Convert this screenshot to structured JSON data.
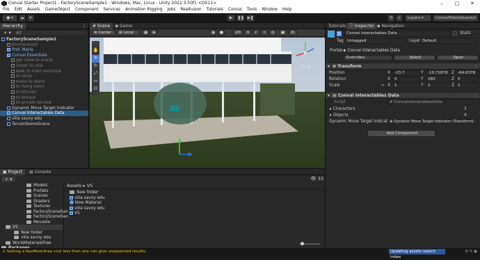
{
  "window": {
    "title": "Convai Starter Project1 - FactorySceneSample1 - Windows, Mac, Linux - Unity 2022.3.50f1 <DX11>"
  },
  "menu": [
    "File",
    "Edit",
    "Assets",
    "GameObject",
    "Component",
    "Services",
    "Animation Rigging",
    "Jobs",
    "Realtusion",
    "Tutorials",
    "Convai",
    "Tools",
    "Window",
    "Help"
  ],
  "toolbar": {
    "layers": "Layers",
    "layout": "ConvaiTutorialLayout"
  },
  "hierarchy": {
    "tab": "Hierarchy",
    "search_placeholder": "All",
    "rows": [
      {
        "label": "FactorySceneSample1",
        "style": "scene"
      },
      {
        "label": "Environment",
        "style": "dim"
      },
      {
        "label": "Prof. Maria",
        "style": "blue"
      },
      {
        "label": "Convai Essentials",
        "style": "blue"
      },
      {
        "label": "get close to maria",
        "style": "dim"
      },
      {
        "label": "closer to villa",
        "style": "dim"
      },
      {
        "label": "walk to main entrance",
        "style": "dim"
      },
      {
        "label": "to ramp",
        "style": "dim"
      },
      {
        "label": "move to stairs",
        "style": "dim"
      },
      {
        "label": "to living room",
        "style": "dim"
      },
      {
        "label": "to kitchen",
        "style": "dim"
      },
      {
        "label": "to terrace",
        "style": "dim"
      },
      {
        "label": "to private terrace",
        "style": "dim"
      },
      {
        "label": "Dynamic Move Target Indicator",
        "style": "normal"
      },
      {
        "label": "Convai Interactables Data",
        "style": "selected"
      },
      {
        "label": "villa savoy edu",
        "style": "normal"
      },
      {
        "label": "TerrainDemoScene",
        "style": "normal"
      }
    ]
  },
  "scene": {
    "tabs": [
      "Scene",
      "Game"
    ],
    "pivot": "Center",
    "space": "Local",
    "mode": "2D",
    "gizmo_label": "Persp"
  },
  "inspector": {
    "tabs": [
      "Tutorials",
      "Inspector",
      "Navigation"
    ],
    "object_name": "Convai Interactables Data",
    "static_label": "Static",
    "tag_label": "Tag",
    "tag_value": "Untagged",
    "layer_label": "Layer",
    "layer_value": "Default",
    "prefab_label": "Prefab",
    "prefab_value": "Convai Interactables Data",
    "overrides": "Overrides",
    "select": "Select",
    "open": "Open",
    "transform": {
      "title": "Transform",
      "position_label": "Position",
      "rotation_label": "Rotation",
      "scale_label": "Scale",
      "position": {
        "x": "-23.7",
        "y": "-10.72878",
        "z": "-64.6378"
      },
      "rotation": {
        "x": "0",
        "y": "180",
        "z": "0"
      },
      "scale": {
        "x": "1",
        "y": "1",
        "z": "1"
      }
    },
    "component": {
      "title": "Convai Interactables Data",
      "script_label": "Script",
      "script_value": "ConvaiInteractablesData",
      "characters_label": "Characters",
      "characters_count": "3",
      "objects_label": "Objects",
      "objects_count": "4",
      "indicator_label": "Dynamic Move Target Indicator",
      "indicator_value": "Dynamic Move Target Indicator (Transform)"
    },
    "add_component": "Add Component"
  },
  "project": {
    "tabs": [
      "Project",
      "Console"
    ],
    "folders": [
      "Models",
      "Prefabs",
      "Scenes",
      "Shaders",
      "Textures",
      "FactorySceneSan",
      "FactorySceneSan",
      "Movable"
    ],
    "tree_lower": [
      "VS",
      "New folder",
      "villa savoy edu",
      "WorldMaterialsFree",
      "Packages"
    ],
    "breadcrumb": [
      "Assets",
      "VS"
    ],
    "assets": [
      "New folder",
      "villa savoy edu",
      "New Material",
      "villa savoy edu",
      "VS"
    ],
    "count": "33"
  },
  "status": {
    "warning": "Setting a NavMeshArea cost less than one can give unexpected results.",
    "progress": "Updating assets search index"
  }
}
